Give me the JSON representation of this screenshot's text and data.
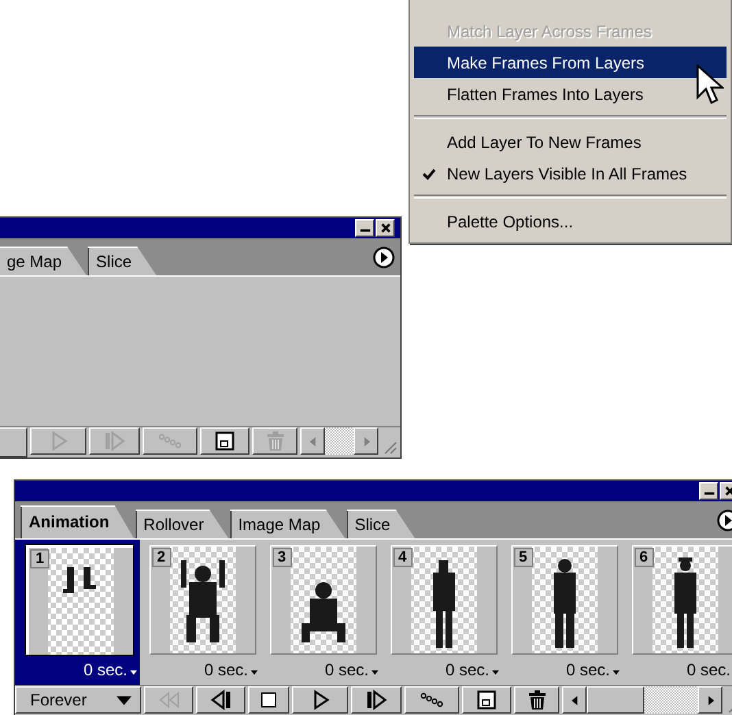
{
  "context_menu": {
    "groups": [
      [
        {
          "label": "Match Layer Across Frames",
          "disabled": true,
          "selected": false,
          "checked": false
        },
        {
          "label": "Make Frames From Layers",
          "disabled": false,
          "selected": true,
          "checked": false
        },
        {
          "label": "Flatten Frames Into Layers",
          "disabled": false,
          "selected": false,
          "checked": false
        }
      ],
      [
        {
          "label": "Add Layer To New Frames",
          "disabled": false,
          "selected": false,
          "checked": false
        },
        {
          "label": "New Layers Visible In All Frames",
          "disabled": false,
          "selected": false,
          "checked": true
        }
      ],
      [
        {
          "label": "Palette Options...",
          "disabled": false,
          "selected": false,
          "checked": false
        }
      ]
    ]
  },
  "small_palette": {
    "tabs": [
      {
        "label": "ge Map",
        "selected": false
      },
      {
        "label": "Slice",
        "selected": false
      }
    ],
    "controls": [
      {
        "kind": "play",
        "disabled": true
      },
      {
        "kind": "next",
        "disabled": true
      },
      {
        "kind": "tween",
        "disabled": true
      },
      {
        "kind": "new",
        "disabled": false
      },
      {
        "kind": "delete",
        "disabled": true
      }
    ]
  },
  "animation_palette": {
    "tabs": [
      {
        "label": "Animation",
        "selected": true
      },
      {
        "label": "Rollover",
        "selected": false
      },
      {
        "label": "Image Map",
        "selected": false
      },
      {
        "label": "Slice",
        "selected": false
      }
    ],
    "frames": [
      {
        "number": "1",
        "delay": "0 sec.",
        "selected": true
      },
      {
        "number": "2",
        "delay": "0 sec.",
        "selected": false
      },
      {
        "number": "3",
        "delay": "0 sec.",
        "selected": false
      },
      {
        "number": "4",
        "delay": "0 sec.",
        "selected": false
      },
      {
        "number": "5",
        "delay": "0 sec.",
        "selected": false
      },
      {
        "number": "6",
        "delay": "0 sec.",
        "selected": false
      }
    ],
    "loop": "Forever",
    "controls": [
      {
        "kind": "first",
        "disabled": true
      },
      {
        "kind": "prev",
        "disabled": false
      },
      {
        "kind": "stop",
        "disabled": false
      },
      {
        "kind": "play",
        "disabled": false
      },
      {
        "kind": "next",
        "disabled": false
      },
      {
        "kind": "tween",
        "disabled": false
      },
      {
        "kind": "new",
        "disabled": false
      },
      {
        "kind": "delete",
        "disabled": false
      }
    ]
  }
}
